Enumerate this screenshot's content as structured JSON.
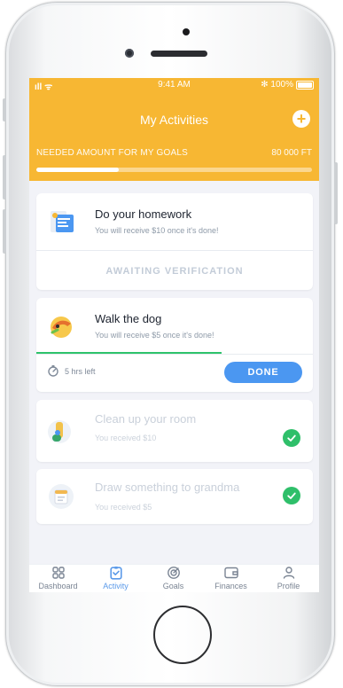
{
  "status": {
    "signal_wifi": "ıll ᯤ",
    "time": "9:41 AM",
    "battery": "✻ 100%"
  },
  "header": {
    "title": "My Activities",
    "needed_label": "NEEDED AMOUNT FOR MY GOALS",
    "needed_amount": "80 000 FT",
    "progress_fraction": 0.3,
    "accent_color": "#f7b733"
  },
  "cards": [
    {
      "title": "Do your homework",
      "subtitle": "You will receive $10 once it's done!",
      "status_text": "AWAITING VERIFICATION",
      "icon": "homework-icon"
    },
    {
      "title": "Walk the dog",
      "subtitle": "You will receive $5 once it's done!",
      "time_left": "5 hrs left",
      "time_progress_fraction": 0.67,
      "action_label": "DONE",
      "icon": "dog-icon"
    },
    {
      "title": "Clean up your room",
      "subtitle": "You received $10",
      "completed": true,
      "icon": "room-icon"
    },
    {
      "title": "Draw something to grandma",
      "subtitle": "You received $5",
      "completed": true,
      "icon": "calendar-icon"
    }
  ],
  "tabs": [
    {
      "label": "Dashboard",
      "icon": "grid-icon",
      "active": false
    },
    {
      "label": "Activity",
      "icon": "clipboard-check-icon",
      "active": true
    },
    {
      "label": "Goals",
      "icon": "target-icon",
      "active": false
    },
    {
      "label": "Finances",
      "icon": "wallet-icon",
      "active": false
    },
    {
      "label": "Profile",
      "icon": "user-icon",
      "active": false
    }
  ]
}
